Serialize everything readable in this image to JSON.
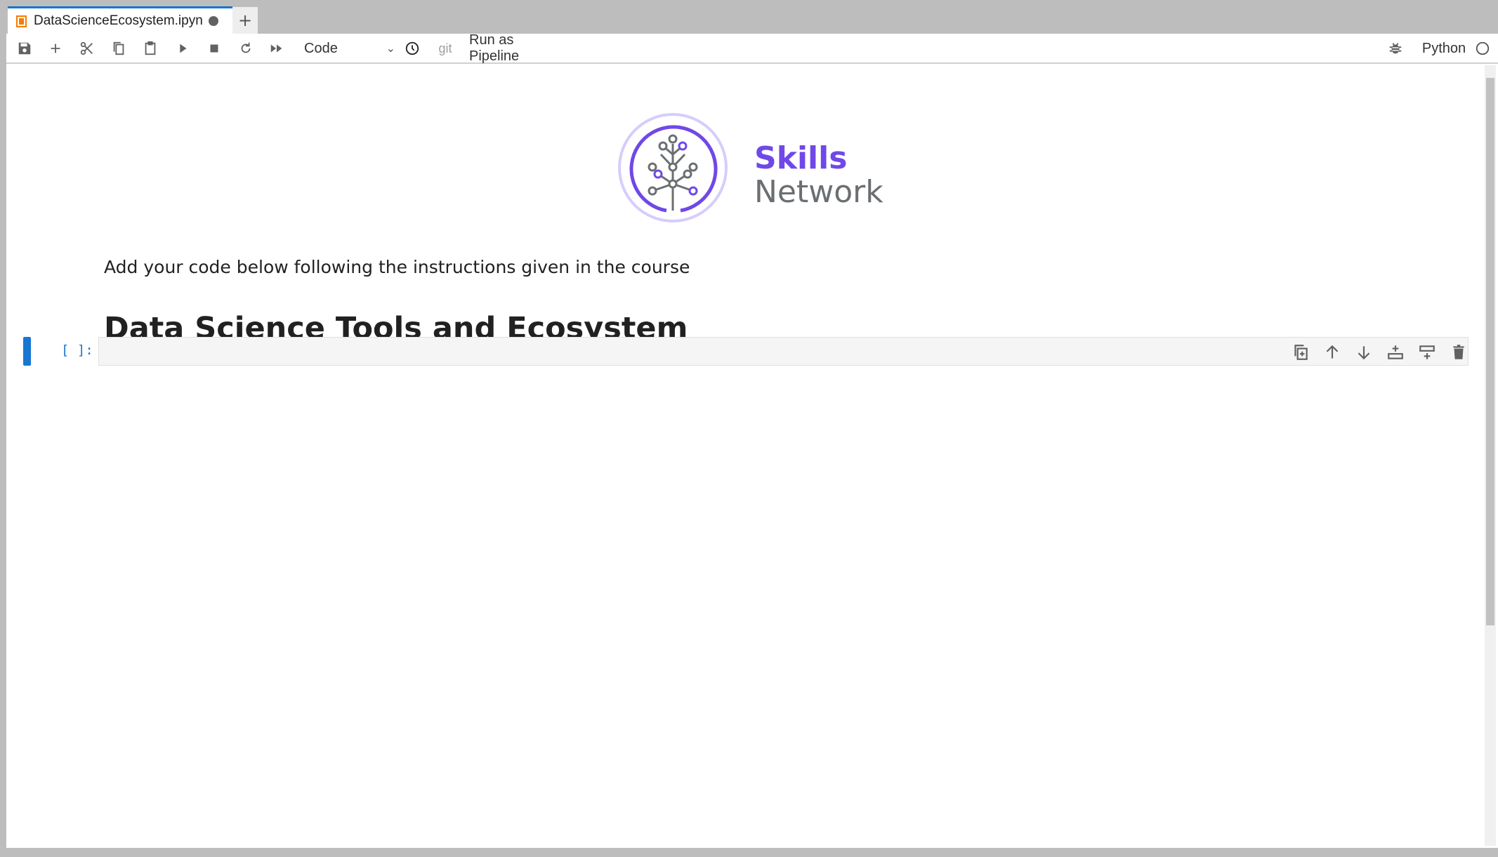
{
  "tabs": [
    {
      "label": "DataScienceEcosystem.ipyn",
      "unsaved": true,
      "active": true
    }
  ],
  "new_tab_label": "+",
  "toolbar": {
    "icons": [
      "save-icon",
      "add-icon",
      "cut-icon",
      "copy-icon",
      "paste-icon",
      "run-icon",
      "stop-icon",
      "restart-icon",
      "run-all-icon"
    ],
    "cell_type": "Code",
    "git_label": "git",
    "run_pipeline_label": "Run as Pipeline",
    "kernel_name": "Python"
  },
  "logo": {
    "line1": "Skills",
    "line2": "Network",
    "colors": {
      "purple": "#7048e8",
      "gray": "#6b6f72",
      "ring": "#d6cdfc"
    }
  },
  "notebook": {
    "markdown_text": "Add your code below following the instructions given in the course",
    "heading": "Data Science Tools and Ecosystem",
    "code_cell": {
      "prompt": "[ ]:",
      "source": ""
    }
  },
  "accent": "#1976d2"
}
